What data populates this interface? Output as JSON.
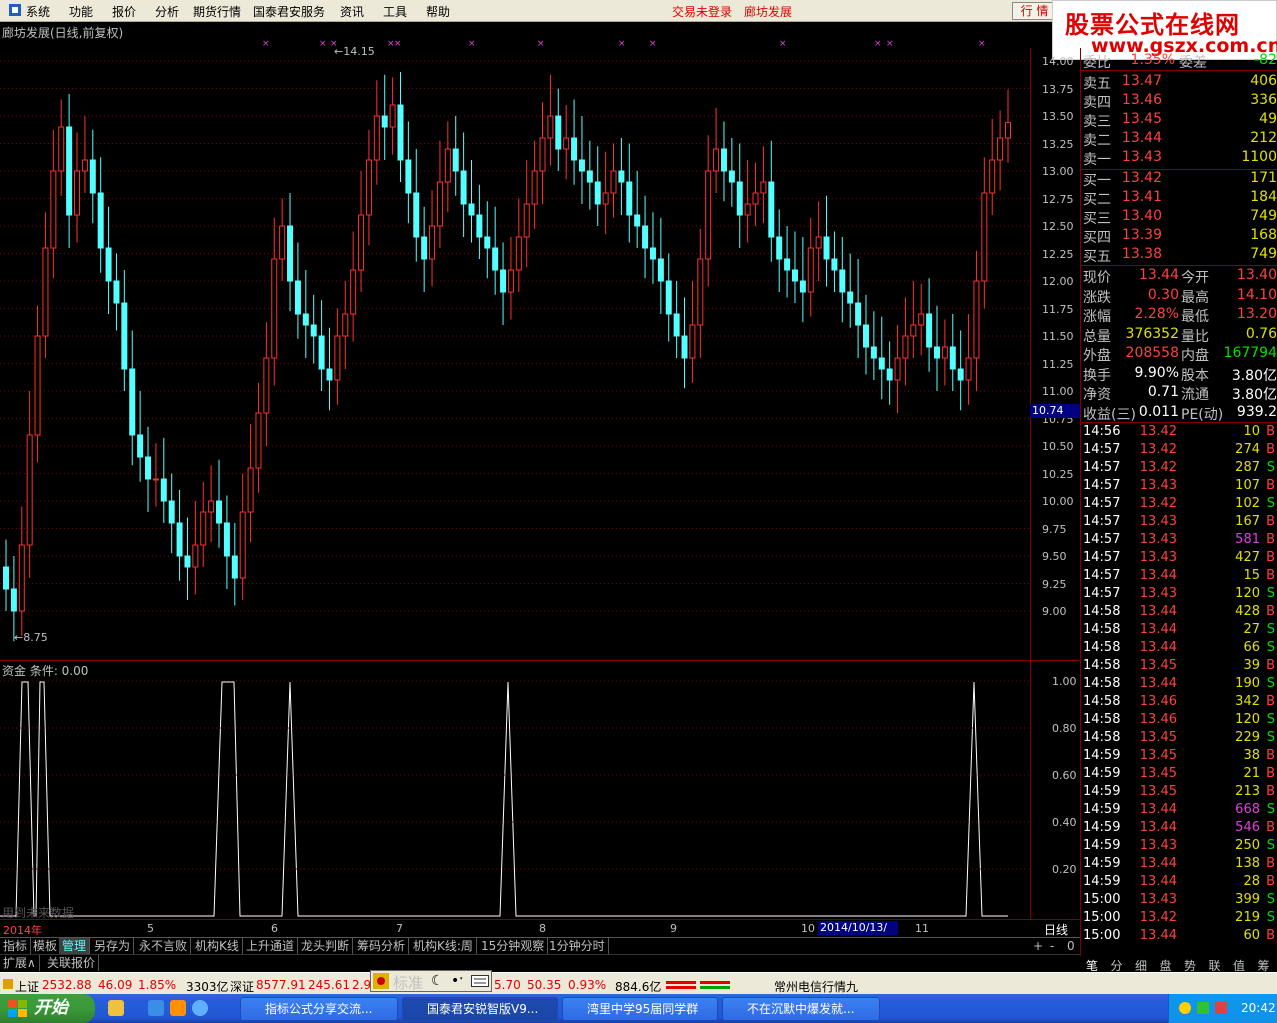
{
  "menu": {
    "items": [
      "系统",
      "功能",
      "报价",
      "分析",
      "期货行情",
      "国泰君安服务",
      "资讯",
      "工具",
      "帮助"
    ],
    "login_status": "交易未登录",
    "stock_name": "廊坊发展",
    "quote_button": "行 情"
  },
  "logo": {
    "line1": "股票公式在线网",
    "line2": "www.gszx.com.cn"
  },
  "chart": {
    "title": "廊坊发展(日线,前复权)",
    "high_label": "14.15",
    "low_label": "8.75",
    "current_tag": "10.74",
    "price_ticks": [
      "14.00",
      "13.75",
      "13.50",
      "13.25",
      "13.00",
      "12.75",
      "12.50",
      "12.25",
      "12.00",
      "11.75",
      "11.50",
      "11.25",
      "11.00",
      "10.75",
      "10.50",
      "10.25",
      "10.00",
      "9.75",
      "9.50",
      "9.25",
      "9.00"
    ],
    "period": "日线"
  },
  "indicator": {
    "title": "资金  条件: 0.00",
    "watermark": "用到未来数据",
    "ticks": [
      "1.00",
      "0.80",
      "0.60",
      "0.40",
      "0.20"
    ]
  },
  "dates": {
    "labels": [
      "2014年",
      "5",
      "6",
      "7",
      "8",
      "9",
      "10",
      "11"
    ],
    "selected": "2014/10/13/一"
  },
  "tabs": {
    "row1": [
      "指标",
      "模板",
      "管理",
      "另存为",
      "永不言败",
      "机构K线",
      "上升通道",
      "龙头判断",
      "筹码分析",
      "机构K线:周",
      "15分钟观察",
      "1分钟分时"
    ],
    "row1_active": "管理",
    "row2": [
      "扩展∧",
      "关联报价"
    ],
    "nav": [
      "+",
      "-",
      "0"
    ]
  },
  "order_book": {
    "top_row": {
      "label": "委比",
      "value": "1.35%",
      "label2": "委差",
      "value2": "-82"
    },
    "sell": [
      {
        "label": "卖五",
        "price": "13.47",
        "vol": "406"
      },
      {
        "label": "卖四",
        "price": "13.46",
        "vol": "336"
      },
      {
        "label": "卖三",
        "price": "13.45",
        "vol": "49"
      },
      {
        "label": "卖二",
        "price": "13.44",
        "vol": "212"
      },
      {
        "label": "卖一",
        "price": "13.43",
        "vol": "1100"
      }
    ],
    "buy": [
      {
        "label": "买一",
        "price": "13.42",
        "vol": "171"
      },
      {
        "label": "买二",
        "price": "13.41",
        "vol": "184"
      },
      {
        "label": "买三",
        "price": "13.40",
        "vol": "749"
      },
      {
        "label": "买四",
        "price": "13.39",
        "vol": "168"
      },
      {
        "label": "买五",
        "price": "13.38",
        "vol": "749"
      }
    ]
  },
  "stats": [
    {
      "l1": "现价",
      "v1": "13.44",
      "c1": "#ff4040",
      "l2": "今开",
      "v2": "13.40",
      "c2": "#ff4040"
    },
    {
      "l1": "涨跌",
      "v1": "0.30",
      "c1": "#ff4040",
      "l2": "最高",
      "v2": "14.10",
      "c2": "#ff4040"
    },
    {
      "l1": "涨幅",
      "v1": "2.28%",
      "c1": "#ff4040",
      "l2": "最低",
      "v2": "13.20",
      "c2": "#ff4040"
    },
    {
      "l1": "总量",
      "v1": "376352",
      "c1": "#e0e000",
      "l2": "量比",
      "v2": "0.76",
      "c2": "#e0e000"
    },
    {
      "l1": "外盘",
      "v1": "208558",
      "c1": "#ff4040",
      "l2": "内盘",
      "v2": "167794",
      "c2": "#00e000"
    },
    {
      "l1": "换手",
      "v1": "9.90%",
      "c1": "#ffffff",
      "l2": "股本",
      "v2": "3.80亿",
      "c2": "#ffffff"
    },
    {
      "l1": "净资",
      "v1": "0.71",
      "c1": "#ffffff",
      "l2": "流通",
      "v2": "3.80亿",
      "c2": "#ffffff"
    },
    {
      "l1": "收益(三)",
      "v1": "0.011",
      "c1": "#ffffff",
      "l2": "PE(动)",
      "v2": "939.2",
      "c2": "#ffffff"
    }
  ],
  "ticks": [
    {
      "t": "14:56",
      "p": "13.42",
      "v": "10",
      "s": "B",
      "vc": "#e0e000"
    },
    {
      "t": "14:57",
      "p": "13.42",
      "v": "274",
      "s": "B",
      "vc": "#e0e000"
    },
    {
      "t": "14:57",
      "p": "13.42",
      "v": "287",
      "s": "S",
      "vc": "#e0e000"
    },
    {
      "t": "14:57",
      "p": "13.43",
      "v": "107",
      "s": "B",
      "vc": "#e0e000"
    },
    {
      "t": "14:57",
      "p": "13.42",
      "v": "102",
      "s": "S",
      "vc": "#e0e000"
    },
    {
      "t": "14:57",
      "p": "13.43",
      "v": "167",
      "s": "B",
      "vc": "#e0e000"
    },
    {
      "t": "14:57",
      "p": "13.43",
      "v": "581",
      "s": "B",
      "vc": "#e040e0"
    },
    {
      "t": "14:57",
      "p": "13.43",
      "v": "427",
      "s": "B",
      "vc": "#e0e000"
    },
    {
      "t": "14:57",
      "p": "13.44",
      "v": "15",
      "s": "B",
      "vc": "#e0e000"
    },
    {
      "t": "14:57",
      "p": "13.43",
      "v": "120",
      "s": "S",
      "vc": "#e0e000"
    },
    {
      "t": "14:58",
      "p": "13.44",
      "v": "428",
      "s": "B",
      "vc": "#e0e000"
    },
    {
      "t": "14:58",
      "p": "13.44",
      "v": "27",
      "s": "S",
      "vc": "#e0e000"
    },
    {
      "t": "14:58",
      "p": "13.44",
      "v": "66",
      "s": "S",
      "vc": "#e0e000"
    },
    {
      "t": "14:58",
      "p": "13.45",
      "v": "39",
      "s": "B",
      "vc": "#e0e000"
    },
    {
      "t": "14:58",
      "p": "13.44",
      "v": "190",
      "s": "S",
      "vc": "#e0e000"
    },
    {
      "t": "14:58",
      "p": "13.46",
      "v": "342",
      "s": "B",
      "vc": "#e0e000"
    },
    {
      "t": "14:58",
      "p": "13.46",
      "v": "120",
      "s": "S",
      "vc": "#e0e000"
    },
    {
      "t": "14:58",
      "p": "13.45",
      "v": "229",
      "s": "S",
      "vc": "#e0e000"
    },
    {
      "t": "14:59",
      "p": "13.45",
      "v": "38",
      "s": "B",
      "vc": "#e0e000"
    },
    {
      "t": "14:59",
      "p": "13.45",
      "v": "21",
      "s": "B",
      "vc": "#e0e000"
    },
    {
      "t": "14:59",
      "p": "13.45",
      "v": "213",
      "s": "B",
      "vc": "#e0e000"
    },
    {
      "t": "14:59",
      "p": "13.44",
      "v": "668",
      "s": "S",
      "vc": "#e040e0"
    },
    {
      "t": "14:59",
      "p": "13.44",
      "v": "546",
      "s": "B",
      "vc": "#e040e0"
    },
    {
      "t": "14:59",
      "p": "13.43",
      "v": "250",
      "s": "S",
      "vc": "#e0e000"
    },
    {
      "t": "14:59",
      "p": "13.44",
      "v": "138",
      "s": "B",
      "vc": "#e0e000"
    },
    {
      "t": "14:59",
      "p": "13.44",
      "v": "28",
      "s": "B",
      "vc": "#e0e000"
    },
    {
      "t": "15:00",
      "p": "13.43",
      "v": "399",
      "s": "S",
      "vc": "#e0e000"
    },
    {
      "t": "15:00",
      "p": "13.42",
      "v": "219",
      "s": "S",
      "vc": "#e0e000"
    },
    {
      "t": "15:00",
      "p": "13.44",
      "v": "60",
      "s": "B",
      "vc": "#e0e000"
    }
  ],
  "right_tabs": [
    "笔",
    "分",
    "细",
    "盘",
    "势",
    "联",
    "值",
    "筹"
  ],
  "status": {
    "sh_label": "上证",
    "sh_val": "2532.88",
    "sh_chg": "46.09",
    "sh_pct": "1.85%",
    "sh_amt": "3303亿",
    "sz_label": "深证",
    "sz_val": "8577.91",
    "sz_chg": "245.61",
    "sz_pct_part": "2.9",
    "mid_val": "5.70",
    "mid_chg": "50.35",
    "mid_pct": "0.93%",
    "mid_amt": "884.6亿",
    "news": "常州电信行情九"
  },
  "ime": {
    "label": "标准"
  },
  "taskbar": {
    "start": "开始",
    "tasks": [
      "指标公式分享交流...",
      "国泰君安锐智版V9...",
      "湾里中学95届同学群",
      "不在沉默中爆发就..."
    ],
    "clock": "20:42"
  },
  "colors": {
    "up": "#ff3030",
    "down": "#54ffff",
    "grid": "#800000"
  }
}
